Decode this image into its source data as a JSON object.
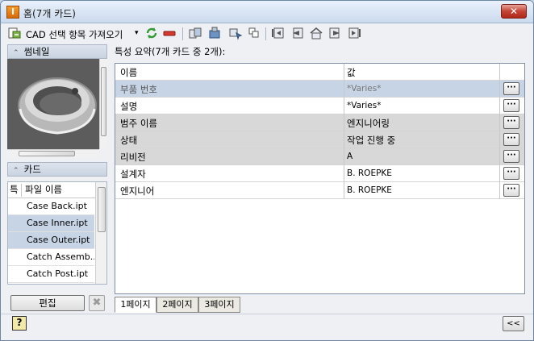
{
  "window": {
    "title": "홈(7개 카드)",
    "app_icon_letter": "I",
    "close_glyph": "✕"
  },
  "toolbar": {
    "cad_label": "CAD 선택 항목 가져오기",
    "cad_dropdown_glyph": "▾",
    "icons": [
      "import-cad-icon",
      "refresh-icon",
      "remove-icon",
      "copy-design-icon",
      "copy-design-2-icon",
      "navigate-icon",
      "link-icon",
      "first-card-icon",
      "previous-card-icon",
      "home-card-icon",
      "next-card-icon",
      "last-card-icon"
    ]
  },
  "left_panel": {
    "thumbnail_label": "썸네일",
    "cards_label": "카드",
    "collapse_glyph": "⌃",
    "file_table": {
      "col1": "특",
      "col2": "파일 이름",
      "rows": [
        {
          "name": "Case Back.ipt",
          "selected": false
        },
        {
          "name": "Case Inner.ipt",
          "selected": true
        },
        {
          "name": "Case Outer.ipt",
          "selected": true
        },
        {
          "name": "Catch Assemb...",
          "selected": false
        },
        {
          "name": "Catch Post.ipt",
          "selected": false
        }
      ]
    },
    "edit_button": "편집",
    "delete_glyph": "✖"
  },
  "main": {
    "summary_label": "특성 요약(7개 카드 중 2개):",
    "columns": {
      "name": "이름",
      "value": "값"
    },
    "properties": [
      {
        "name": "부품 번호",
        "value": "*Varies*",
        "style": "blue",
        "muted": true
      },
      {
        "name": "설명",
        "value": "*Varies*",
        "style": "white",
        "muted": false
      },
      {
        "name": "범주 이름",
        "value": "엔지니어링",
        "style": "gray",
        "muted": false
      },
      {
        "name": "상태",
        "value": "작업 진행 중",
        "style": "gray",
        "muted": false
      },
      {
        "name": "리비전",
        "value": "A",
        "style": "gray",
        "muted": false
      },
      {
        "name": "설계자",
        "value": "B. ROEPKE",
        "style": "white",
        "muted": false
      },
      {
        "name": "엔지니어",
        "value": "B. ROEPKE",
        "style": "white",
        "muted": false
      }
    ],
    "ellipsis": "···",
    "pages": [
      "1페이지",
      "2페이지",
      "3페이지"
    ],
    "active_page": 0
  },
  "footer": {
    "help_glyph": "?",
    "collapse_label": "<<"
  },
  "colors": {
    "row_selected": "#c6d4e6",
    "row_gray": "#d8d8d8",
    "title_gradient": "#cbdaee"
  }
}
